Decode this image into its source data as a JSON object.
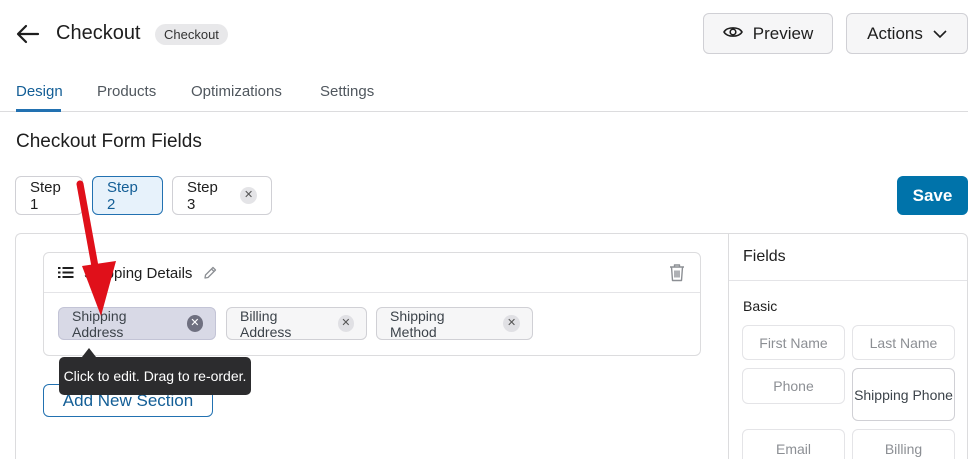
{
  "header": {
    "title": "Checkout",
    "badge": "Checkout",
    "preview_label": "Preview",
    "actions_label": "Actions"
  },
  "tabs": [
    {
      "label": "Design",
      "active": true
    },
    {
      "label": "Products",
      "active": false
    },
    {
      "label": "Optimizations",
      "active": false
    },
    {
      "label": "Settings",
      "active": false
    }
  ],
  "section_title": "Checkout Form Fields",
  "steps": [
    {
      "label": "Step 1",
      "active": false
    },
    {
      "label": "Step 2",
      "active": true
    },
    {
      "label": "Step 3",
      "active": false,
      "removable": true
    }
  ],
  "save_label": "Save",
  "card": {
    "title": "Shipping Details",
    "chips": [
      {
        "label": "Shipping Address",
        "selected": true
      },
      {
        "label": "Billing Address",
        "selected": false
      },
      {
        "label": "Shipping Method",
        "selected": false
      }
    ]
  },
  "tooltip": "Click to edit. Drag to re-order.",
  "add_section_label": "Add New Section",
  "fields_panel": {
    "title": "Fields",
    "group": "Basic",
    "items": [
      "First Name",
      "Last Name",
      "Phone",
      "Shipping Phone",
      "Email",
      "Billing"
    ]
  },
  "colors": {
    "accent": "#0073aa",
    "tab_active": "#135e96",
    "annotation_arrow": "#e0101a",
    "tooltip_bg": "#2c2c2e"
  }
}
